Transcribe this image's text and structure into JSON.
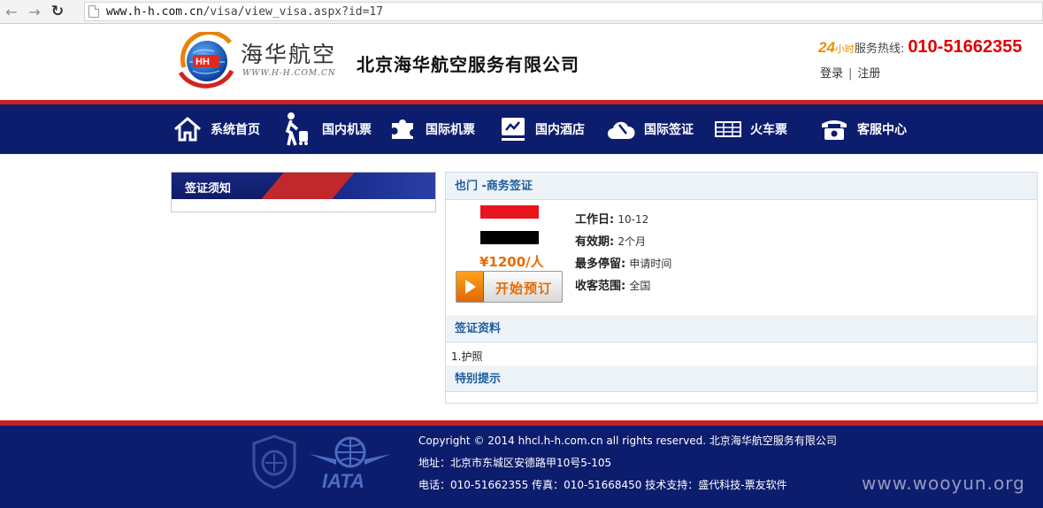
{
  "browser": {
    "url_host": "www.h-h.com.cn",
    "url_path": "/visa/view_visa.aspx?id=17"
  },
  "header": {
    "logo_cn": "海华航空",
    "logo_url": "WWW.H-H.COM.CN",
    "company": "北京海华航空服务有限公司",
    "hotline_24": "24",
    "hotline_hours": "小时",
    "hotline_label": "服务热线:",
    "hotline_number": "010-51662355",
    "login": "登录",
    "separator": "|",
    "register": "注册"
  },
  "nav": {
    "items": [
      {
        "label": "系统首页",
        "icon": "home-icon"
      },
      {
        "label": "国内机票",
        "icon": "traveler-icon"
      },
      {
        "label": "国际机票",
        "icon": "puzzle-icon"
      },
      {
        "label": "国内酒店",
        "icon": "hotel-icon"
      },
      {
        "label": "国际签证",
        "icon": "cloud-visa-icon"
      },
      {
        "label": "火车票",
        "icon": "train-ticket-icon"
      },
      {
        "label": "客服中心",
        "icon": "phone-icon"
      }
    ]
  },
  "sidebar": {
    "title": "签证须知"
  },
  "visa": {
    "title": "也门 -商务签证",
    "price": "¥1200/人",
    "book_label": "开始预订",
    "fields": [
      {
        "label": "工作日",
        "value": "10-12"
      },
      {
        "label": "有效期",
        "value": "2个月"
      },
      {
        "label": "最多停留",
        "value": "申请时间"
      },
      {
        "label": "收客范围",
        "value": "全国"
      }
    ],
    "colon": ":",
    "materials_title": "签证资料",
    "materials_item": "1.护照",
    "notice_title": "特别提示"
  },
  "footer": {
    "copyright": "Copyright © 2014 hhcl.h-h.com.cn all rights reserved. 北京海华航空服务有限公司",
    "address": "地址：北京市东城区安德路甲10号5-105",
    "contact": "电话：010-51662355 传真：010-51668450  技术支持：盛代科技-票友软件",
    "iata": "IATA",
    "watermark": "www.wooyun.org"
  },
  "colors": {
    "navy": "#0d1d6e",
    "red": "#cc1f22",
    "accent_orange": "#e86b00",
    "section_blue": "#1f5e9c"
  }
}
